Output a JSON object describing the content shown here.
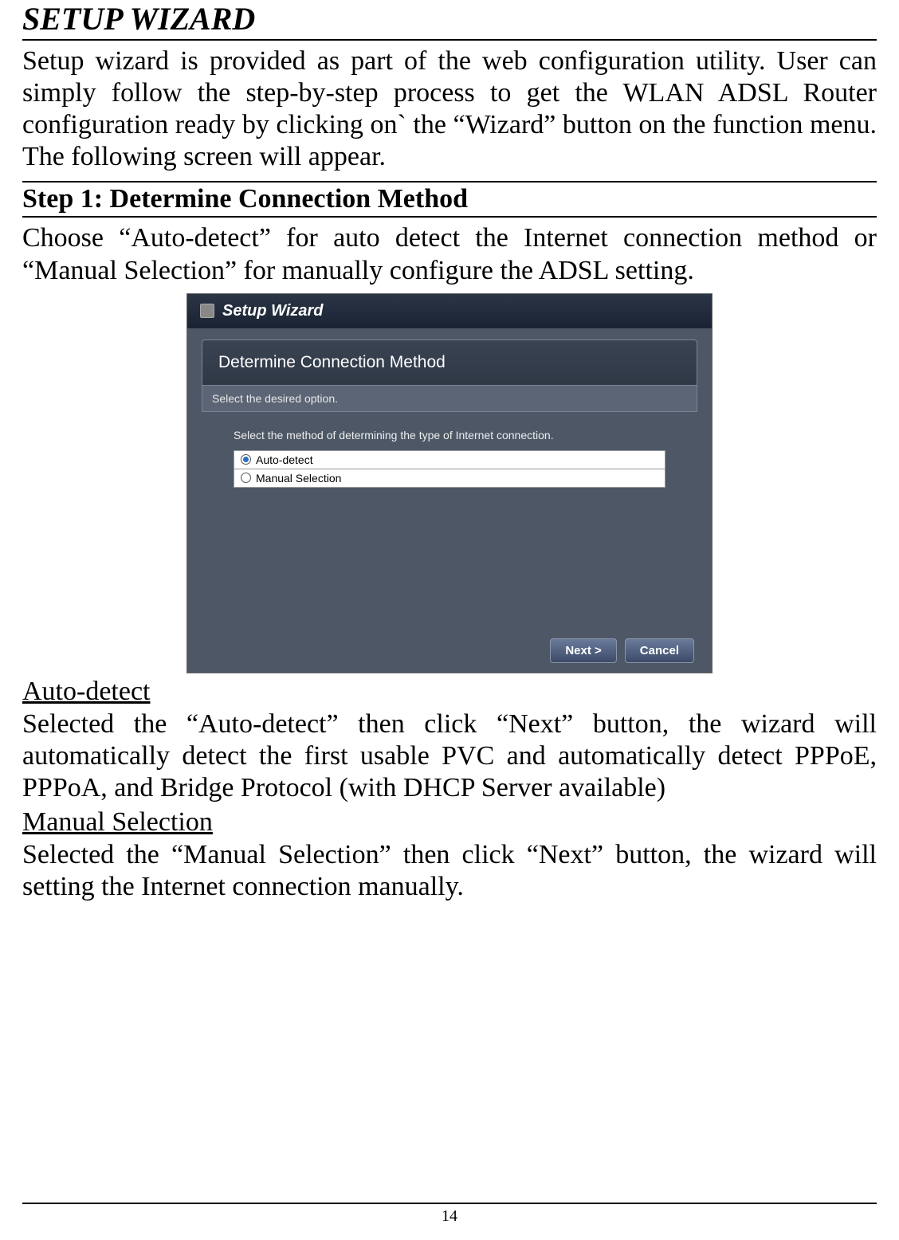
{
  "page": {
    "title": "SETUP WIZARD",
    "intro": "Setup wizard is provided as part of the web configuration utility. User can simply follow the step-by-step process to get the WLAN ADSL Router configuration ready by clicking on` the “Wizard” button on the function menu. The following screen will appear.",
    "step_heading": "Step 1: Determine Connection Method",
    "step_text": "Choose “Auto-detect” for auto detect the Internet connection method or “Manual Selection” for manually configure the ADSL setting.",
    "auto_heading": "Auto-detect",
    "auto_text": "Selected the “Auto-detect” then click “Next” button, the wizard will automatically detect the first usable PVC and automatically detect PPPoE, PPPoA, and Bridge Protocol (with DHCP Server available)",
    "manual_heading": "Manual Selection",
    "manual_text": "Selected the “Manual Selection” then click “Next” button, the wizard will setting the Internet connection manually.",
    "page_number": "14"
  },
  "wizard": {
    "title": "Setup Wizard",
    "panel_title": "Determine Connection Method",
    "subtitle": "Select the desired option.",
    "prompt": "Select the method of determining the type of Internet connection.",
    "options": [
      {
        "label": "Auto-detect",
        "selected": true
      },
      {
        "label": "Manual Selection",
        "selected": false
      }
    ],
    "buttons": {
      "next": "Next >",
      "cancel": "Cancel"
    }
  }
}
